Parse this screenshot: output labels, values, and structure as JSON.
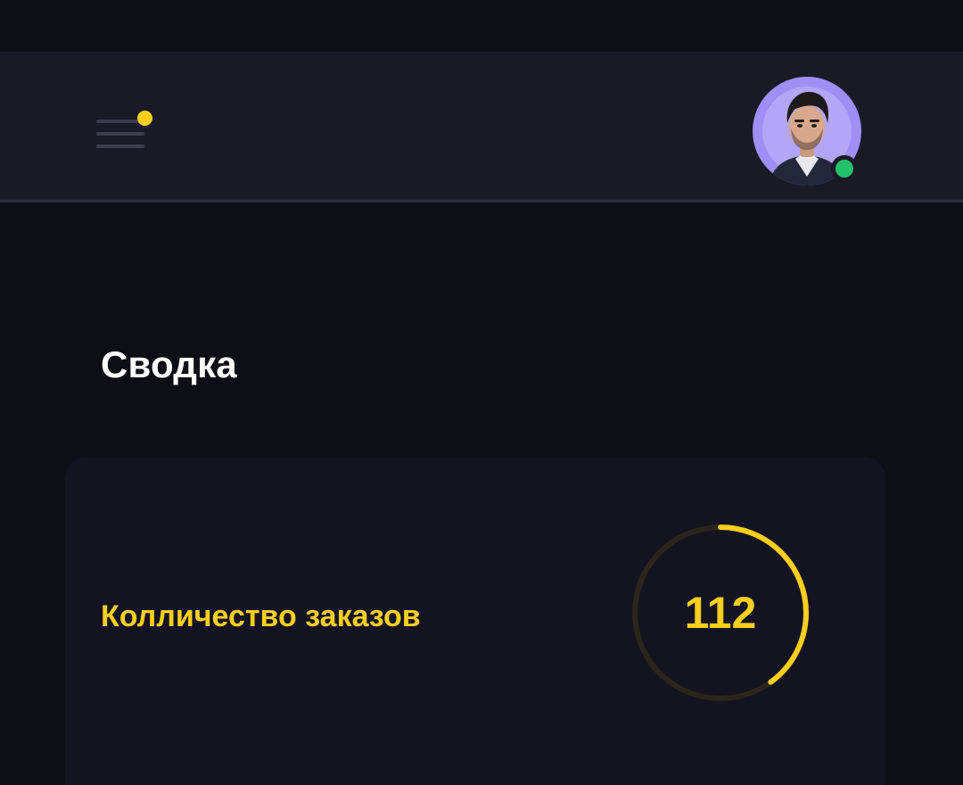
{
  "header": {
    "menu_icon": "hamburger-menu-icon",
    "notification_indicator": true,
    "avatar": {
      "icon": "user-avatar-photo",
      "status": "online"
    }
  },
  "page": {
    "title": "Сводка"
  },
  "summary_card": {
    "label": "Колличество заказов",
    "value": "112",
    "progress_fraction": 0.4
  },
  "colors": {
    "background": "#0e0e16",
    "topbar": "#1a1a27",
    "card": "#141420",
    "accent": "#ffcf1a",
    "online": "#21c16b",
    "avatar_bg": "#9f8ef5"
  }
}
